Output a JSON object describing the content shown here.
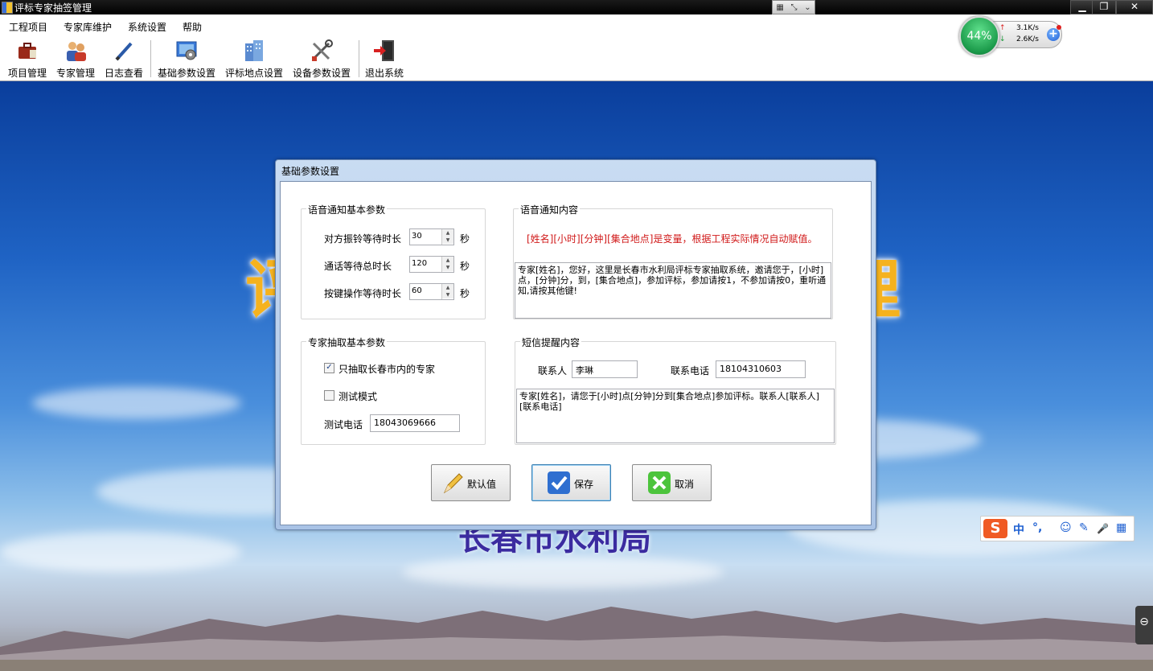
{
  "window": {
    "title": "评标专家抽签管理",
    "rd_toolbar": {
      "icons": [
        "grid-icon",
        "resize-icon",
        "chevron-down-icon"
      ],
      "glyphs": [
        "▦",
        "⤡",
        "⌄"
      ]
    },
    "controls": {
      "minimize": "▁",
      "restore": "❐",
      "close": "✕"
    }
  },
  "menu": {
    "items": [
      "工程项目",
      "专家库维护",
      "系统设置",
      "帮助"
    ]
  },
  "toolbar": {
    "project_manage": "项目管理",
    "expert_manage": "专家管理",
    "log_view": "日志查看",
    "basic_params": "基础参数设置",
    "venue_settings": "评标地点设置",
    "device_params": "设备参数设置",
    "exit_system": "退出系统"
  },
  "net_widget": {
    "percent": "44%",
    "upload_arrow": "↑",
    "download_arrow": "↓",
    "upload": "3.1K/s",
    "download": "2.6K/s",
    "plus": "+"
  },
  "background": {
    "title_left": "评",
    "title_right": "理",
    "subtitle": "长春市水利局"
  },
  "dialog": {
    "title": "基础参数设置",
    "voice_params": {
      "title": "语音通知基本参数",
      "ring_wait_label": "对方振铃等待时长",
      "ring_wait_value": "30",
      "call_total_label": "通话等待总时长",
      "call_total_value": "120",
      "key_wait_label": "按键操作等待时长",
      "key_wait_value": "60",
      "unit": "秒"
    },
    "voice_content": {
      "title": "语音通知内容",
      "note": "[姓名][小时][分钟][集合地点]是变量，根据工程实际情况自动赋值。",
      "text": "专家[姓名]，您好，这里是长春市水利局评标专家抽取系统，邀请您于，[小时]点，[分钟]分，到，[集合地点]，参加评标，参加请按1，不参加请按0，重听通知,请按其他键!"
    },
    "expert_params": {
      "title": "专家抽取基本参数",
      "only_local_label": "只抽取长春市内的专家",
      "only_local_checked": true,
      "test_mode_label": "测试模式",
      "test_mode_checked": false,
      "test_phone_label": "测试电话",
      "test_phone_value": "18043069666"
    },
    "sms_content": {
      "title": "短信提醒内容",
      "contact_label": "联系人",
      "contact_value": "李琳",
      "phone_label": "联系电话",
      "phone_value": "18104310603",
      "text": "专家[姓名]，请您于[小时]点[分钟]分到[集合地点]参加评标。联系人[联系人][联系电话]"
    },
    "buttons": {
      "default": "默认值",
      "save": "保存",
      "cancel": "取消"
    }
  },
  "ime": {
    "logo": "S",
    "lang": "中",
    "punct": "°,",
    "emoji_icon": "☺",
    "pen_icon": "✎",
    "mic_icon": "🎤",
    "grid_icon": "▦"
  },
  "side_tab": {
    "glyph": "⊖"
  }
}
